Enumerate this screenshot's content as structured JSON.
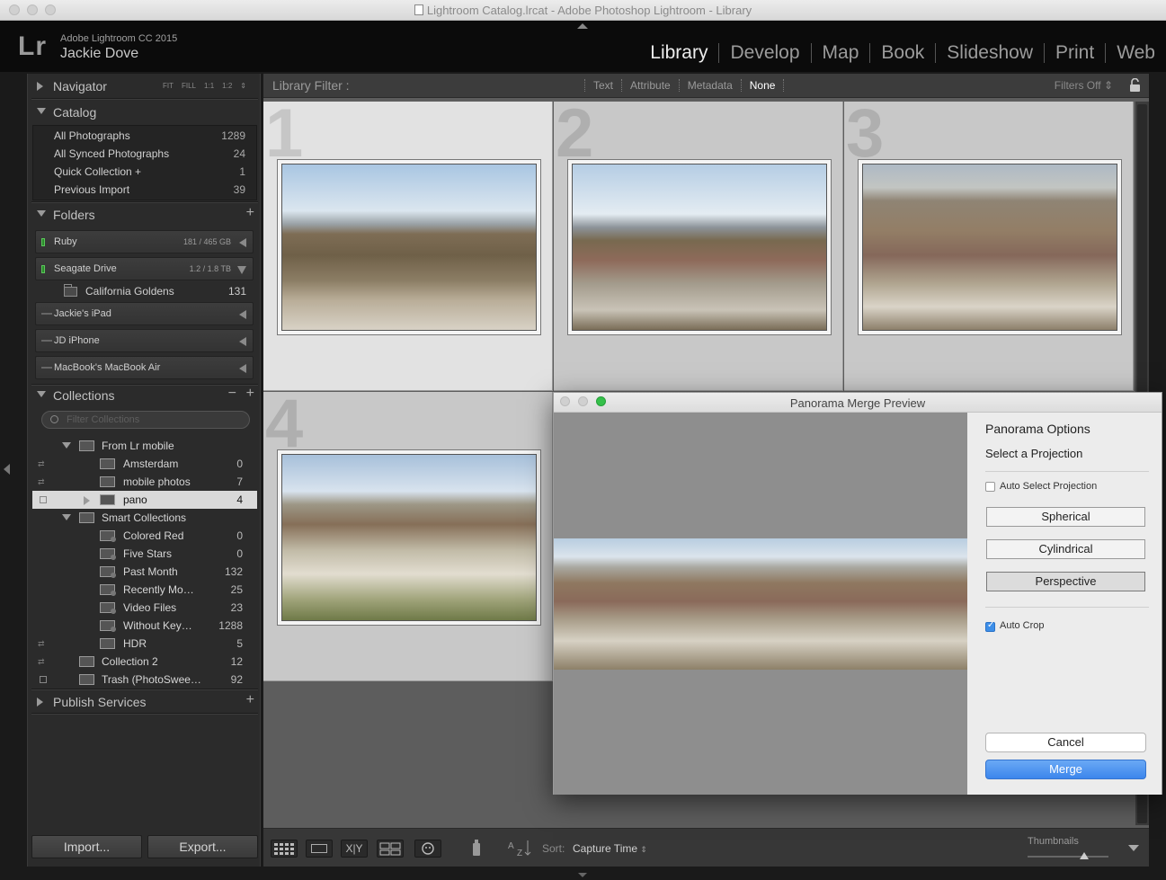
{
  "window": {
    "title": "Lightroom Catalog.lrcat - Adobe Photoshop Lightroom - Library"
  },
  "identity": {
    "logo": "Lr",
    "app_version": "Adobe Lightroom CC 2015",
    "user_name": "Jackie Dove"
  },
  "modules": [
    "Library",
    "Develop",
    "Map",
    "Book",
    "Slideshow",
    "Print",
    "Web"
  ],
  "active_module": "Library",
  "left_panel": {
    "navigator": {
      "label": "Navigator",
      "zoom_options": [
        "FIT",
        "FILL",
        "1:1",
        "1:2"
      ]
    },
    "catalog": {
      "label": "Catalog",
      "items": [
        {
          "label": "All Photographs",
          "count": "1289"
        },
        {
          "label": "All Synced Photographs",
          "count": "24"
        },
        {
          "label": "Quick Collection +",
          "count": "1"
        },
        {
          "label": "Previous Import",
          "count": "39"
        }
      ]
    },
    "folders": {
      "label": "Folders",
      "volumes": [
        {
          "name": "Ruby",
          "size": "181 / 465 GB",
          "online": true
        },
        {
          "name": "Seagate Drive",
          "size": "1.2 / 1.8 TB",
          "online": true
        }
      ],
      "subfolder": {
        "name": "California Goldens",
        "count": "131"
      },
      "offline_volumes": [
        "Jackie's iPad",
        "JD iPhone",
        "MacBook's MacBook Air"
      ]
    },
    "collections": {
      "label": "Collections",
      "filter_placeholder": "Filter Collections",
      "items": [
        {
          "label": "From Lr mobile",
          "count": ""
        },
        {
          "label": "Amsterdam",
          "count": "0"
        },
        {
          "label": "mobile photos",
          "count": "7"
        },
        {
          "label": "pano",
          "count": "4"
        },
        {
          "label": "Smart Collections",
          "count": ""
        },
        {
          "label": "Colored Red",
          "count": "0"
        },
        {
          "label": "Five Stars",
          "count": "0"
        },
        {
          "label": "Past Month",
          "count": "132"
        },
        {
          "label": "Recently Mo…",
          "count": "25"
        },
        {
          "label": "Video Files",
          "count": "23"
        },
        {
          "label": "Without Key…",
          "count": "1288"
        },
        {
          "label": "HDR",
          "count": "5"
        },
        {
          "label": "Collection 2",
          "count": "12"
        },
        {
          "label": "Trash (PhotoSwee…",
          "count": "92"
        }
      ]
    },
    "publish_services": {
      "label": "Publish Services"
    },
    "import_label": "Import...",
    "export_label": "Export..."
  },
  "library_filter": {
    "title": "Library Filter :",
    "tabs": [
      "Text",
      "Attribute",
      "Metadata",
      "None"
    ],
    "active_tab": "None",
    "filters_status": "Filters Off"
  },
  "grid": {
    "cells": [
      {
        "index": "1",
        "selected": true
      },
      {
        "index": "2",
        "selected": false
      },
      {
        "index": "3",
        "selected": false
      },
      {
        "index": "4",
        "selected": false
      }
    ]
  },
  "toolbar": {
    "sort_label": "Sort:",
    "sort_value": "Capture Time",
    "thumbnails_label": "Thumbnails",
    "thumbnail_size": 0.7
  },
  "panorama_dialog": {
    "title": "Panorama Merge Preview",
    "options_title": "Panorama Options",
    "projection_label": "Select a Projection",
    "auto_select_label": "Auto Select Projection",
    "auto_select_checked": false,
    "projections": [
      "Spherical",
      "Cylindrical",
      "Perspective"
    ],
    "selected_projection": "Perspective",
    "auto_crop_label": "Auto Crop",
    "auto_crop_checked": true,
    "cancel_label": "Cancel",
    "merge_label": "Merge"
  },
  "colors": {
    "accent": "#3c86ec",
    "selected_row": "#d9d9d9",
    "online_led": "#2c8a2c"
  }
}
